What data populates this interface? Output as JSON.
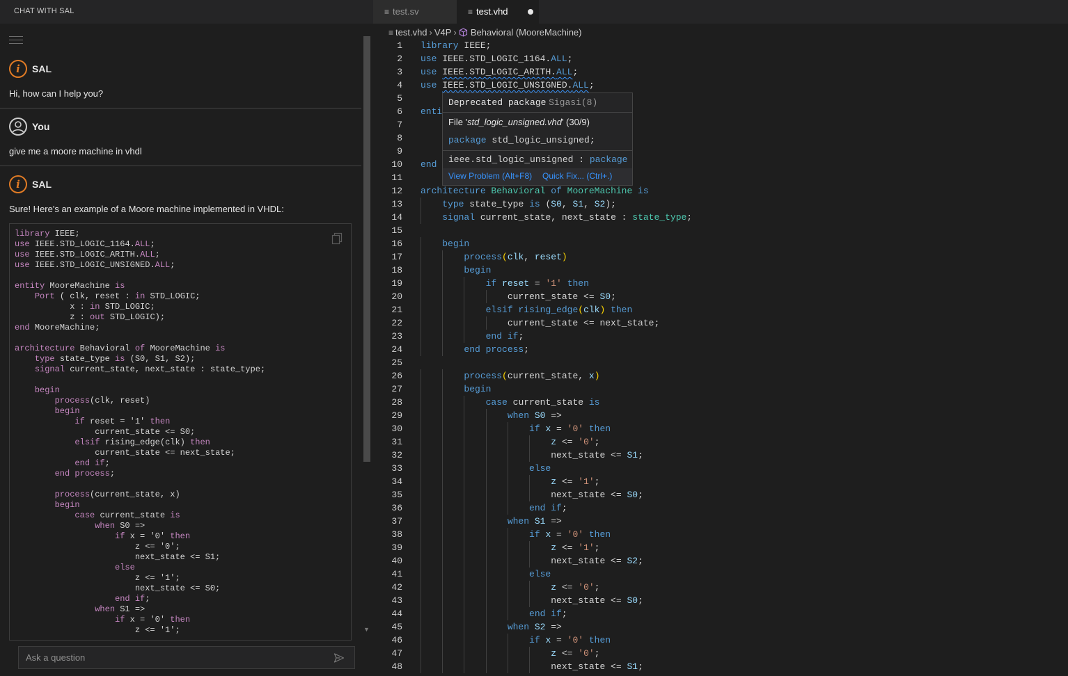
{
  "chat_panel": {
    "title": "CHAT WITH SAL",
    "messages": [
      {
        "author": "SAL",
        "text": "Hi, how can I help you?"
      },
      {
        "author": "You",
        "text": "give me a moore machine in vhdl"
      },
      {
        "author": "SAL",
        "text": "Sure! Here's an example of a Moore machine implemented in VHDL:"
      }
    ],
    "code_block": [
      "library IEEE;",
      "use IEEE.STD_LOGIC_1164.ALL;",
      "use IEEE.STD_LOGIC_ARITH.ALL;",
      "use IEEE.STD_LOGIC_UNSIGNED.ALL;",
      "",
      "entity MooreMachine is",
      "    Port ( clk, reset : in STD_LOGIC;",
      "           x : in STD_LOGIC;",
      "           z : out STD_LOGIC);",
      "end MooreMachine;",
      "",
      "architecture Behavioral of MooreMachine is",
      "    type state_type is (S0, S1, S2);",
      "    signal current_state, next_state : state_type;",
      "",
      "    begin",
      "        process(clk, reset)",
      "        begin",
      "            if reset = '1' then",
      "                current_state <= S0;",
      "            elsif rising_edge(clk) then",
      "                current_state <= next_state;",
      "            end if;",
      "        end process;",
      "",
      "        process(current_state, x)",
      "        begin",
      "            case current_state is",
      "                when S0 =>",
      "                    if x = '0' then",
      "                        z <= '0';",
      "                        next_state <= S1;",
      "                    else",
      "                        z <= '1';",
      "                        next_state <= S0;",
      "                    end if;",
      "                when S1 =>",
      "                    if x = '0' then",
      "                        z <= '1';"
    ],
    "input_placeholder": "Ask a question"
  },
  "tabs": [
    {
      "label": "test.sv",
      "active": false
    },
    {
      "label": "test.vhd",
      "active": true,
      "modified": true
    }
  ],
  "breadcrumb": [
    "test.vhd",
    "V4P",
    "Behavioral (MooreMachine)"
  ],
  "hover": {
    "title_a": "Deprecated package",
    "title_b": "Sigasi(8)",
    "file_prefix": "File '",
    "file_name": "std_logic_unsigned.vhd",
    "file_suffix": "' (30/9)",
    "decl_kw": "package",
    "decl_name": "std_logic_unsigned;",
    "sig_name": "ieee.std_logic_unsigned",
    "sig_colon": ":",
    "sig_type": "package",
    "action_view": "View Problem (Alt+F8)",
    "action_fix": "Quick Fix... (Ctrl+.)"
  },
  "colors": {
    "sal_accent": "#e07b25",
    "keyword": "#569cd6",
    "type": "#4ec9b0",
    "variable": "#9cdcfe",
    "string": "#ce9178",
    "function": "#dcdcaa",
    "link": "#3794ff"
  },
  "editor_lines": [
    [
      [
        "k",
        "library"
      ],
      [
        "t",
        " IEEE;"
      ]
    ],
    [
      [
        "k",
        "use"
      ],
      [
        "t",
        " IEEE.STD_LOGIC_1164."
      ],
      [
        "k",
        "ALL"
      ],
      [
        "t",
        ";"
      ]
    ],
    [
      [
        "k",
        "use"
      ],
      [
        "t",
        " "
      ],
      [
        "q",
        "IEEE.STD_LOGIC_ARITH."
      ],
      [
        "qk",
        "ALL"
      ],
      [
        "t",
        ";"
      ]
    ],
    [
      [
        "k",
        "use"
      ],
      [
        "t",
        " "
      ],
      [
        "q",
        "IEEE.STD_LOGIC_UNSIGNED."
      ],
      [
        "qk",
        "ALL"
      ],
      [
        "t",
        ";"
      ]
    ],
    [],
    [
      [
        "k",
        "enti"
      ]
    ],
    [],
    [],
    [],
    [
      [
        "k",
        "end"
      ]
    ],
    [],
    [
      [
        "k",
        "architecture"
      ],
      [
        "tp",
        " Behavioral"
      ],
      [
        "k",
        " of"
      ],
      [
        "tp",
        " MooreMachine"
      ],
      [
        "k",
        " is"
      ]
    ],
    [
      [
        "t",
        "    "
      ],
      [
        "k",
        "type"
      ],
      [
        "t",
        " state_type "
      ],
      [
        "k",
        "is"
      ],
      [
        "t",
        " ("
      ],
      [
        "v",
        "S0"
      ],
      [
        "t",
        ", "
      ],
      [
        "v",
        "S1"
      ],
      [
        "t",
        ", "
      ],
      [
        "v",
        "S2"
      ],
      [
        "t",
        ");"
      ]
    ],
    [
      [
        "t",
        "    "
      ],
      [
        "k",
        "signal"
      ],
      [
        "t",
        " current_state, next_state : "
      ],
      [
        "tp",
        "state_type"
      ],
      [
        "t",
        ";"
      ]
    ],
    [],
    [
      [
        "t",
        "    "
      ],
      [
        "k",
        "begin"
      ]
    ],
    [
      [
        "t",
        "        "
      ],
      [
        "k",
        "process"
      ],
      [
        "pk",
        "("
      ],
      [
        "v",
        "clk"
      ],
      [
        "t",
        ", "
      ],
      [
        "v",
        "reset"
      ],
      [
        "pk",
        ")"
      ]
    ],
    [
      [
        "t",
        "        "
      ],
      [
        "k",
        "begin"
      ]
    ],
    [
      [
        "t",
        "            "
      ],
      [
        "k",
        "if"
      ],
      [
        "v",
        " reset"
      ],
      [
        "t",
        " = "
      ],
      [
        "s",
        "'1'"
      ],
      [
        "k",
        " then"
      ]
    ],
    [
      [
        "t",
        "                current_state <= "
      ],
      [
        "v",
        "S0"
      ],
      [
        "t",
        ";"
      ]
    ],
    [
      [
        "t",
        "            "
      ],
      [
        "k",
        "elsif rising_edge"
      ],
      [
        "pk",
        "("
      ],
      [
        "v",
        "clk"
      ],
      [
        "pk",
        ")"
      ],
      [
        "k",
        " then"
      ]
    ],
    [
      [
        "t",
        "                current_state <= next_state;"
      ]
    ],
    [
      [
        "t",
        "            "
      ],
      [
        "k",
        "end if"
      ],
      [
        "t",
        ";"
      ]
    ],
    [
      [
        "t",
        "        "
      ],
      [
        "k",
        "end process"
      ],
      [
        "t",
        ";"
      ]
    ],
    [],
    [
      [
        "t",
        "        "
      ],
      [
        "k",
        "process"
      ],
      [
        "pk",
        "("
      ],
      [
        "t",
        "current_state, "
      ],
      [
        "v",
        "x"
      ],
      [
        "pk",
        ")"
      ]
    ],
    [
      [
        "t",
        "        "
      ],
      [
        "k",
        "begin"
      ]
    ],
    [
      [
        "t",
        "            "
      ],
      [
        "k",
        "case"
      ],
      [
        "t",
        " current_state "
      ],
      [
        "k",
        "is"
      ]
    ],
    [
      [
        "t",
        "                "
      ],
      [
        "k",
        "when"
      ],
      [
        "v",
        " S0"
      ],
      [
        "t",
        " =>"
      ]
    ],
    [
      [
        "t",
        "                    "
      ],
      [
        "k",
        "if"
      ],
      [
        "v",
        " x"
      ],
      [
        "t",
        " = "
      ],
      [
        "s",
        "'0'"
      ],
      [
        "k",
        " then"
      ]
    ],
    [
      [
        "t",
        "                        "
      ],
      [
        "v",
        "z"
      ],
      [
        "t",
        " <= "
      ],
      [
        "s",
        "'0'"
      ],
      [
        "t",
        ";"
      ]
    ],
    [
      [
        "t",
        "                        next_state <= "
      ],
      [
        "v",
        "S1"
      ],
      [
        "t",
        ";"
      ]
    ],
    [
      [
        "t",
        "                    "
      ],
      [
        "k",
        "else"
      ]
    ],
    [
      [
        "t",
        "                        "
      ],
      [
        "v",
        "z"
      ],
      [
        "t",
        " <= "
      ],
      [
        "s",
        "'1'"
      ],
      [
        "t",
        ";"
      ]
    ],
    [
      [
        "t",
        "                        next_state <= "
      ],
      [
        "v",
        "S0"
      ],
      [
        "t",
        ";"
      ]
    ],
    [
      [
        "t",
        "                    "
      ],
      [
        "k",
        "end if"
      ],
      [
        "t",
        ";"
      ]
    ],
    [
      [
        "t",
        "                "
      ],
      [
        "k",
        "when"
      ],
      [
        "v",
        " S1"
      ],
      [
        "t",
        " =>"
      ]
    ],
    [
      [
        "t",
        "                    "
      ],
      [
        "k",
        "if"
      ],
      [
        "v",
        " x"
      ],
      [
        "t",
        " = "
      ],
      [
        "s",
        "'0'"
      ],
      [
        "k",
        " then"
      ]
    ],
    [
      [
        "t",
        "                        "
      ],
      [
        "v",
        "z"
      ],
      [
        "t",
        " <= "
      ],
      [
        "s",
        "'1'"
      ],
      [
        "t",
        ";"
      ]
    ],
    [
      [
        "t",
        "                        next_state <= "
      ],
      [
        "v",
        "S2"
      ],
      [
        "t",
        ";"
      ]
    ],
    [
      [
        "t",
        "                    "
      ],
      [
        "k",
        "else"
      ]
    ],
    [
      [
        "t",
        "                        "
      ],
      [
        "v",
        "z"
      ],
      [
        "t",
        " <= "
      ],
      [
        "s",
        "'0'"
      ],
      [
        "t",
        ";"
      ]
    ],
    [
      [
        "t",
        "                        next_state <= "
      ],
      [
        "v",
        "S0"
      ],
      [
        "t",
        ";"
      ]
    ],
    [
      [
        "t",
        "                    "
      ],
      [
        "k",
        "end if"
      ],
      [
        "t",
        ";"
      ]
    ],
    [
      [
        "t",
        "                "
      ],
      [
        "k",
        "when"
      ],
      [
        "v",
        " S2"
      ],
      [
        "t",
        " =>"
      ]
    ],
    [
      [
        "t",
        "                    "
      ],
      [
        "k",
        "if"
      ],
      [
        "v",
        " x"
      ],
      [
        "t",
        " = "
      ],
      [
        "s",
        "'0'"
      ],
      [
        "k",
        " then"
      ]
    ],
    [
      [
        "t",
        "                        "
      ],
      [
        "v",
        "z"
      ],
      [
        "t",
        " <= "
      ],
      [
        "s",
        "'0'"
      ],
      [
        "t",
        ";"
      ]
    ],
    [
      [
        "t",
        "                        next_state <= "
      ],
      [
        "v",
        "S1"
      ],
      [
        "t",
        ";"
      ]
    ]
  ]
}
